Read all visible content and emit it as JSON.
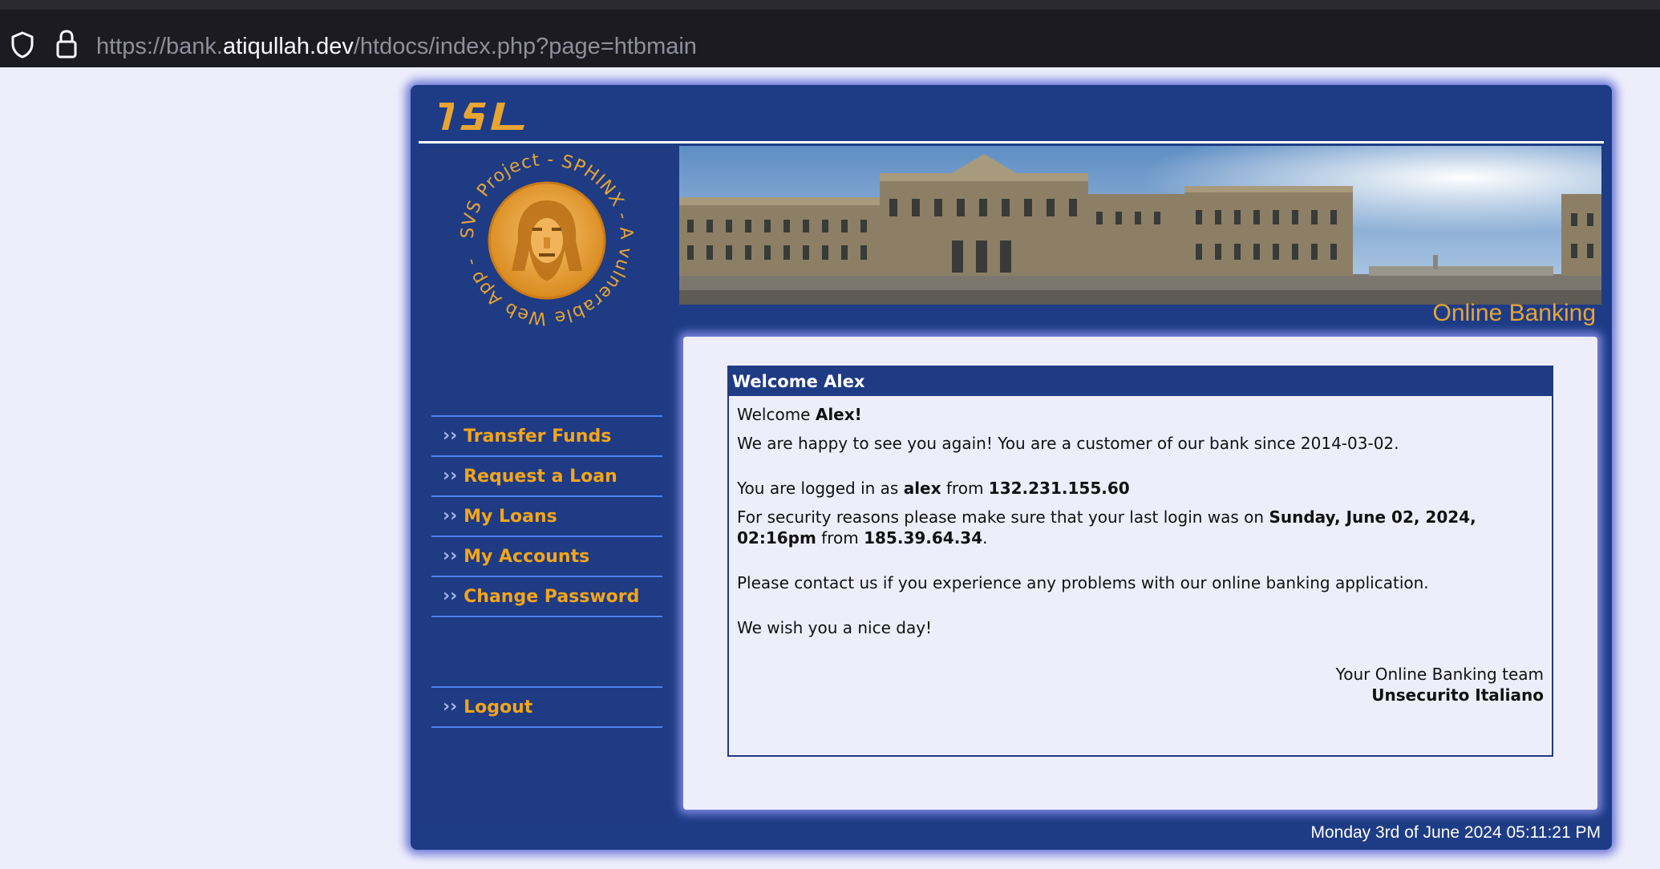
{
  "browser": {
    "url_scheme": "https://bank.",
    "url_host": "atiqullah.dev",
    "url_path": "/htdocs/index.php?page=htbmain"
  },
  "brand": {
    "logo_text": "ISL",
    "sphinx_ring_text": "SVS Project - SPHINX - A vulnerable Web App -",
    "banner_caption": "Online Banking"
  },
  "nav": {
    "items": [
      {
        "label": "Transfer Funds"
      },
      {
        "label": "Request a Loan"
      },
      {
        "label": "My Loans"
      },
      {
        "label": "My Accounts"
      },
      {
        "label": "Change Password"
      }
    ],
    "logout": {
      "label": "Logout"
    },
    "chevron": "››"
  },
  "welcome": {
    "heading": "Welcome Alex",
    "greeting_prefix": "Welcome ",
    "greeting_name": "Alex!",
    "customer_since_text": "We are happy to see you again! You are a customer of our bank since 2014-03-02.",
    "logged_in_prefix": "You are logged in as ",
    "username": "alex",
    "logged_in_from": " from ",
    "current_ip": "132.231.155.60",
    "security_prefix": "For security reasons please make sure that your last login was on ",
    "last_login": "Sunday, June 02, 2024, 02:16pm",
    "security_from": " from ",
    "last_ip": "185.39.64.34",
    "security_suffix": ".",
    "contact_text": "Please contact us if you experience any problems with our online banking application.",
    "nice_day": "We wish you a nice day!",
    "signature_line1": "Your Online Banking team",
    "signature_line2": "Unsecurito Italiano"
  },
  "footer": {
    "datetime": "Monday 3rd of June 2024 05:11:21 PM"
  },
  "colors": {
    "page_bg": "#eeeefb",
    "frame_blue": "#1e3c86",
    "nav_orange": "#f3a51c",
    "nav_divider": "#4d82f0",
    "banner_caption": "#e8a531"
  }
}
